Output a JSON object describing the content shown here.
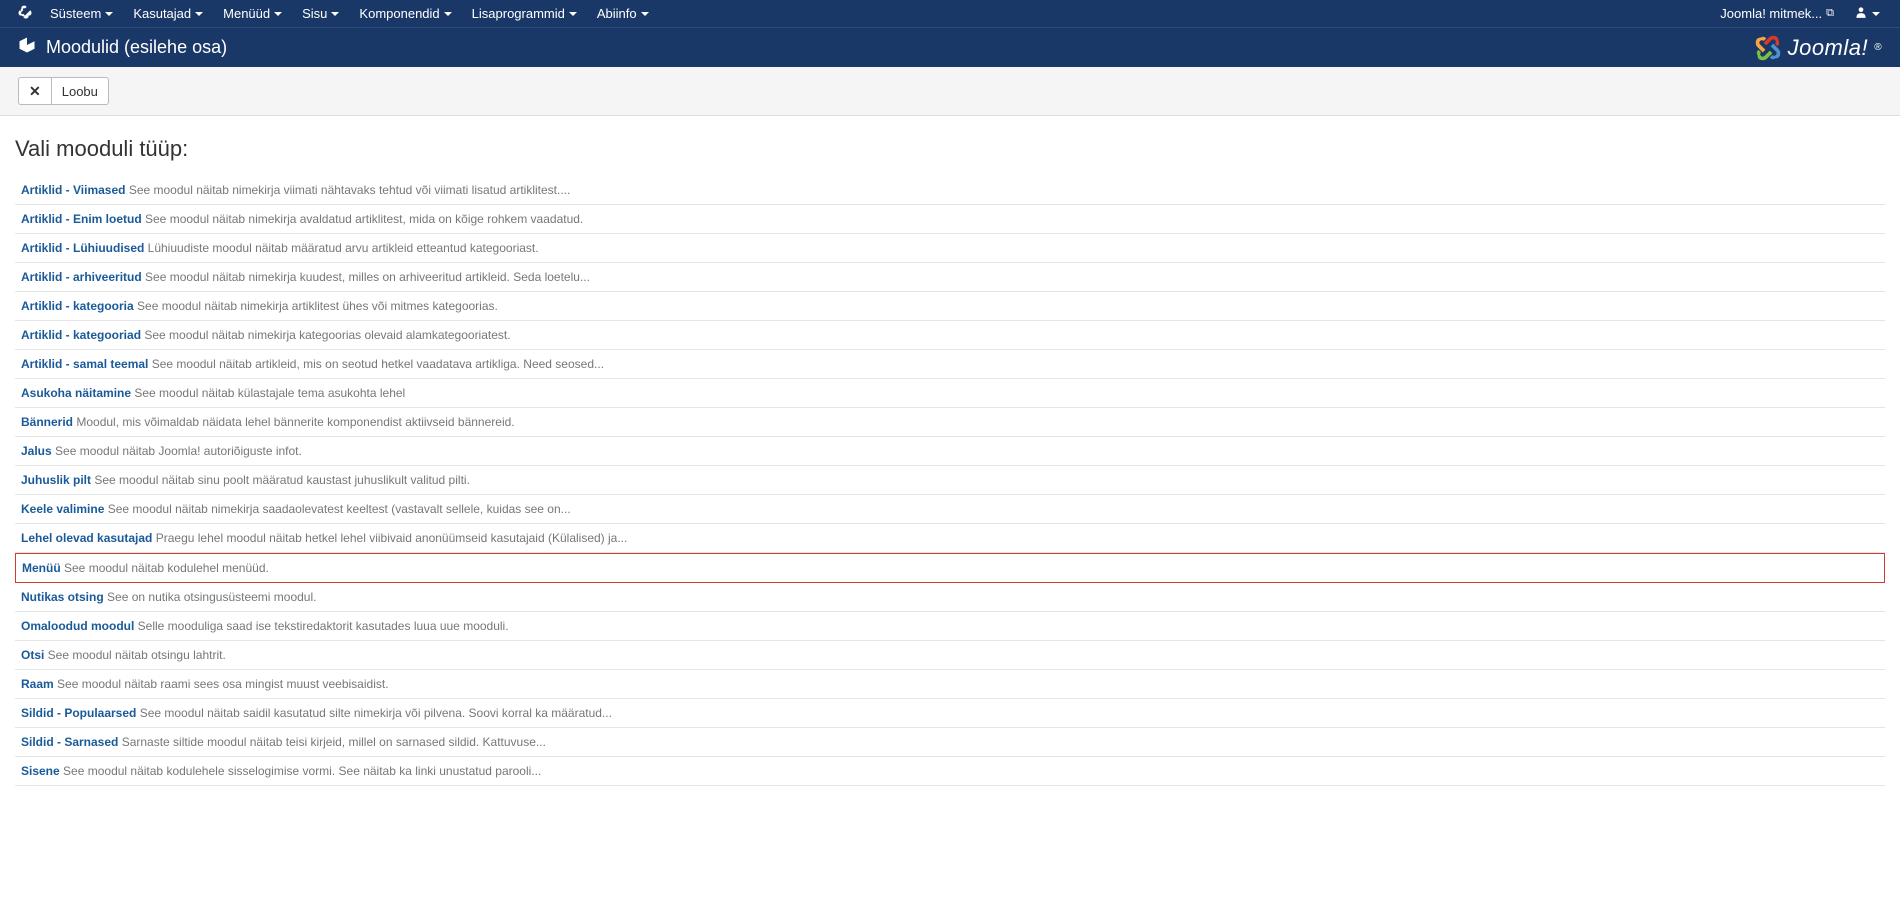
{
  "topmenu": {
    "items": [
      {
        "label": "Süsteem",
        "caret": true
      },
      {
        "label": "Kasutajad",
        "caret": true
      },
      {
        "label": "Menüüd",
        "caret": true
      },
      {
        "label": "Sisu",
        "caret": true
      },
      {
        "label": "Komponendid",
        "caret": true
      },
      {
        "label": "Lisaprogrammid",
        "caret": true
      },
      {
        "label": "Abiinfo",
        "caret": true
      }
    ],
    "site_link": "Joomla! mitmek..."
  },
  "header": {
    "title": "Moodulid (esilehe osa)",
    "brand": "Joomla!"
  },
  "toolbar": {
    "cancel_label": "Loobu"
  },
  "content": {
    "heading": "Vali mooduli tüüp:"
  },
  "modules": [
    {
      "name": "Artiklid - Viimased",
      "desc": "See moodul näitab nimekirja viimati nähtavaks tehtud või viimati lisatud artiklitest...."
    },
    {
      "name": "Artiklid - Enim loetud",
      "desc": "See moodul näitab nimekirja avaldatud artiklitest, mida on kõige rohkem vaadatud."
    },
    {
      "name": "Artiklid - Lühiuudised",
      "desc": "Lühiuudiste moodul näitab määratud arvu artikleid etteantud kategooriast."
    },
    {
      "name": "Artiklid - arhiveeritud",
      "desc": "See moodul näitab nimekirja kuudest, milles on arhiveeritud artikleid. Seda loetelu..."
    },
    {
      "name": "Artiklid - kategooria",
      "desc": "See moodul näitab nimekirja artiklitest ühes või mitmes kategoorias."
    },
    {
      "name": "Artiklid - kategooriad",
      "desc": "See moodul näitab nimekirja kategoorias olevaid alamkategooriatest."
    },
    {
      "name": "Artiklid - samal teemal",
      "desc": "See moodul näitab artikleid, mis on seotud hetkel vaadatava artikliga. Need seosed..."
    },
    {
      "name": "Asukoha näitamine",
      "desc": "See moodul näitab külastajale tema asukohta lehel"
    },
    {
      "name": "Bännerid",
      "desc": "Moodul, mis võimaldab näidata lehel bännerite komponendist aktiivseid bännereid."
    },
    {
      "name": "Jalus",
      "desc": "See moodul näitab Joomla! autoriõiguste infot."
    },
    {
      "name": "Juhuslik pilt",
      "desc": "See moodul näitab sinu poolt määratud kaustast juhuslikult valitud pilti."
    },
    {
      "name": "Keele valimine",
      "desc": "See moodul näitab nimekirja saadaolevatest keeltest (vastavalt sellele, kuidas see on..."
    },
    {
      "name": "Lehel olevad kasutajad",
      "desc": "Praegu lehel moodul näitab hetkel lehel viibivaid anonüümseid kasutajaid (Külalised) ja..."
    },
    {
      "name": "Menüü",
      "desc": "See moodul näitab kodulehel menüüd.",
      "highlighted": true
    },
    {
      "name": "Nutikas otsing",
      "desc": "See on nutika otsingusüsteemi moodul."
    },
    {
      "name": "Omaloodud moodul",
      "desc": "Selle mooduliga saad ise tekstiredaktorit kasutades luua uue mooduli."
    },
    {
      "name": "Otsi",
      "desc": "See moodul näitab otsingu lahtrit."
    },
    {
      "name": "Raam",
      "desc": "See moodul näitab raami sees osa mingist muust veebisaidist."
    },
    {
      "name": "Sildid - Populaarsed",
      "desc": "See moodul näitab saidil kasutatud silte nimekirja või pilvena. Soovi korral ka määratud..."
    },
    {
      "name": "Sildid - Sarnased",
      "desc": "Sarnaste siltide moodul näitab teisi kirjeid, millel on sarnased sildid. Kattuvuse..."
    },
    {
      "name": "Sisene",
      "desc": "See moodul näitab kodulehele sisselogimise vormi. See näitab ka linki unustatud parooli..."
    }
  ]
}
